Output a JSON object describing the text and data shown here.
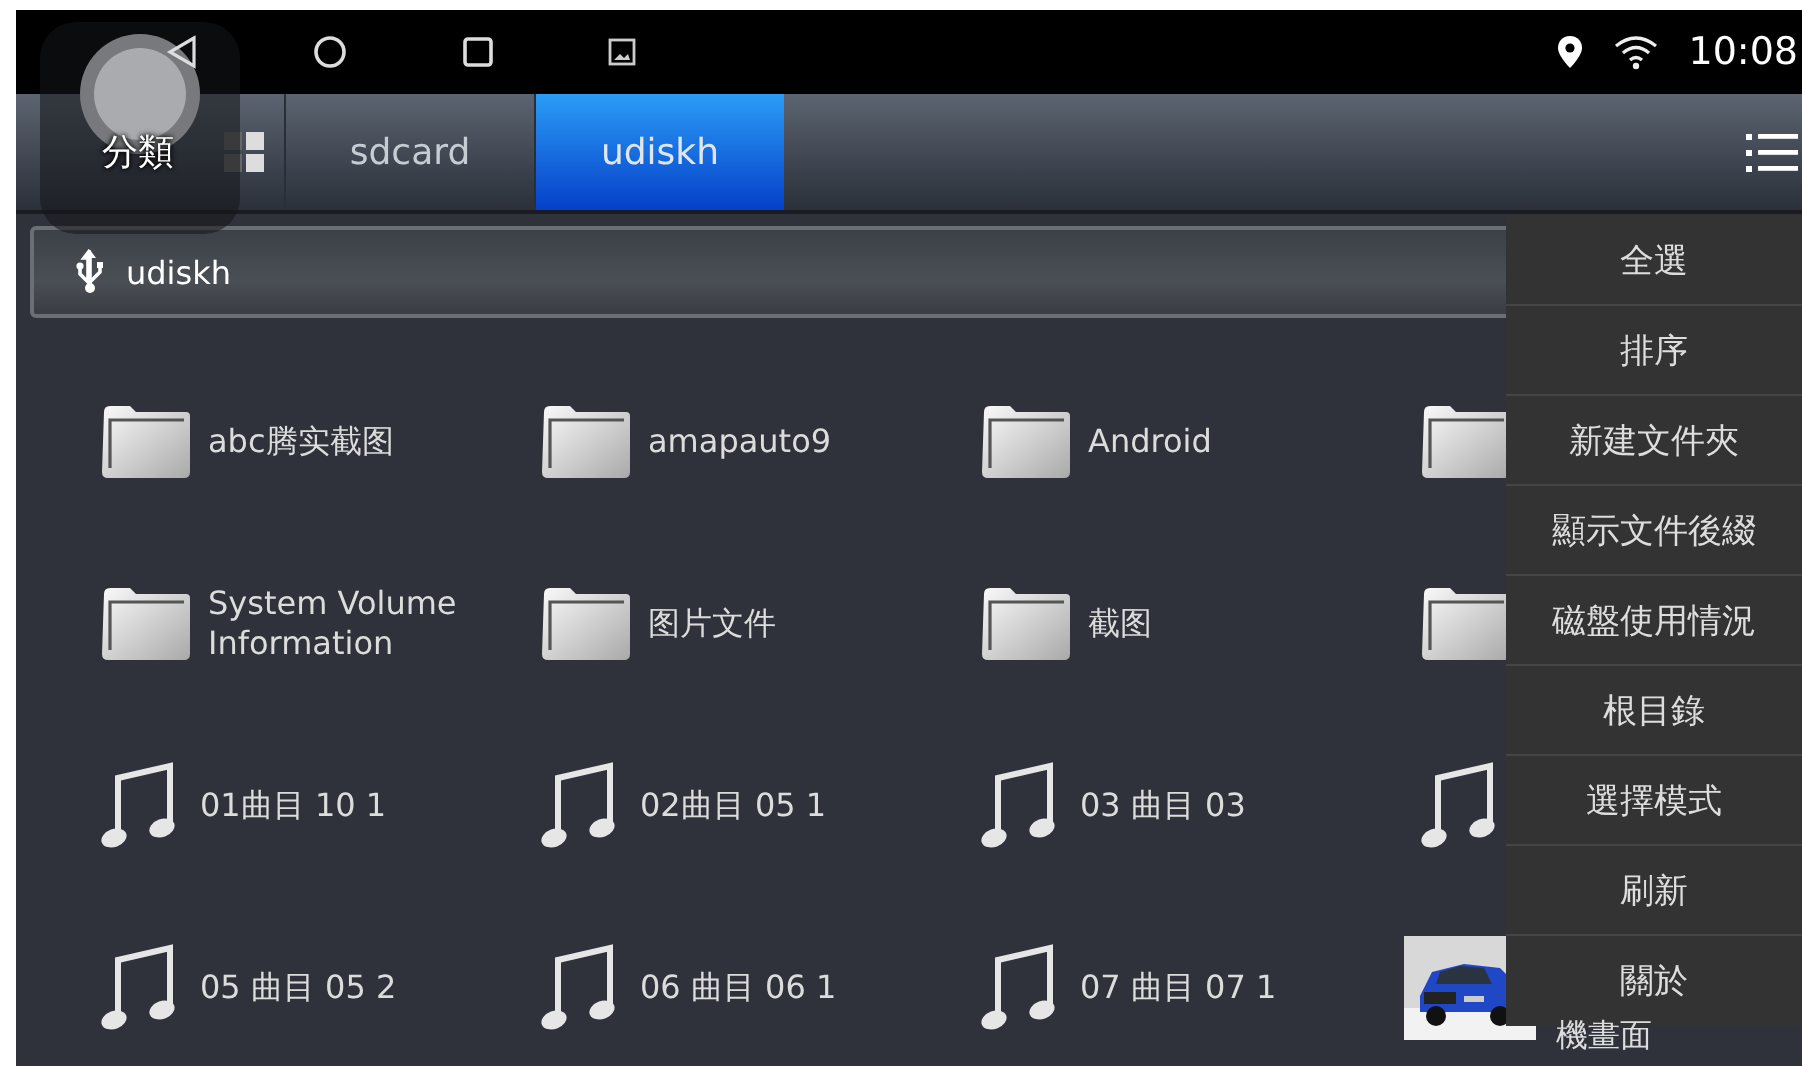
{
  "status_bar": {
    "time": "10:08"
  },
  "tabs": [
    {
      "label": "分類",
      "kind": "category",
      "selected": false
    },
    {
      "label": "sdcard",
      "kind": "storage",
      "selected": false
    },
    {
      "label": "udiskh",
      "kind": "storage",
      "selected": true
    }
  ],
  "path": {
    "value": "udiskh"
  },
  "files": [
    {
      "kind": "folder",
      "label": "abc腾实截图"
    },
    {
      "kind": "folder",
      "label": "amapauto9"
    },
    {
      "kind": "folder",
      "label": "Android"
    },
    {
      "kind": "folder"
    },
    {
      "kind": "folder",
      "label": "System Volume Information"
    },
    {
      "kind": "folder",
      "label": "图片文件"
    },
    {
      "kind": "folder",
      "label": "截图"
    },
    {
      "kind": "folder"
    },
    {
      "kind": "music",
      "label": "01曲目 10 1"
    },
    {
      "kind": "music",
      "label": "02曲目 05 1"
    },
    {
      "kind": "music",
      "label": "03 曲目 03"
    },
    {
      "kind": "music"
    },
    {
      "kind": "music",
      "label": "05 曲目 05 2"
    },
    {
      "kind": "music",
      "label": "06 曲目 06 1"
    },
    {
      "kind": "music",
      "label": "07 曲目 07 1"
    },
    {
      "kind": "picture",
      "label": "機畫面"
    }
  ],
  "menu": {
    "items": [
      "全選",
      "排序",
      "新建文件夾",
      "顯示文件後綴",
      "磁盤使用情況",
      "根目錄",
      "選擇模式",
      "刷新",
      "關於"
    ]
  }
}
